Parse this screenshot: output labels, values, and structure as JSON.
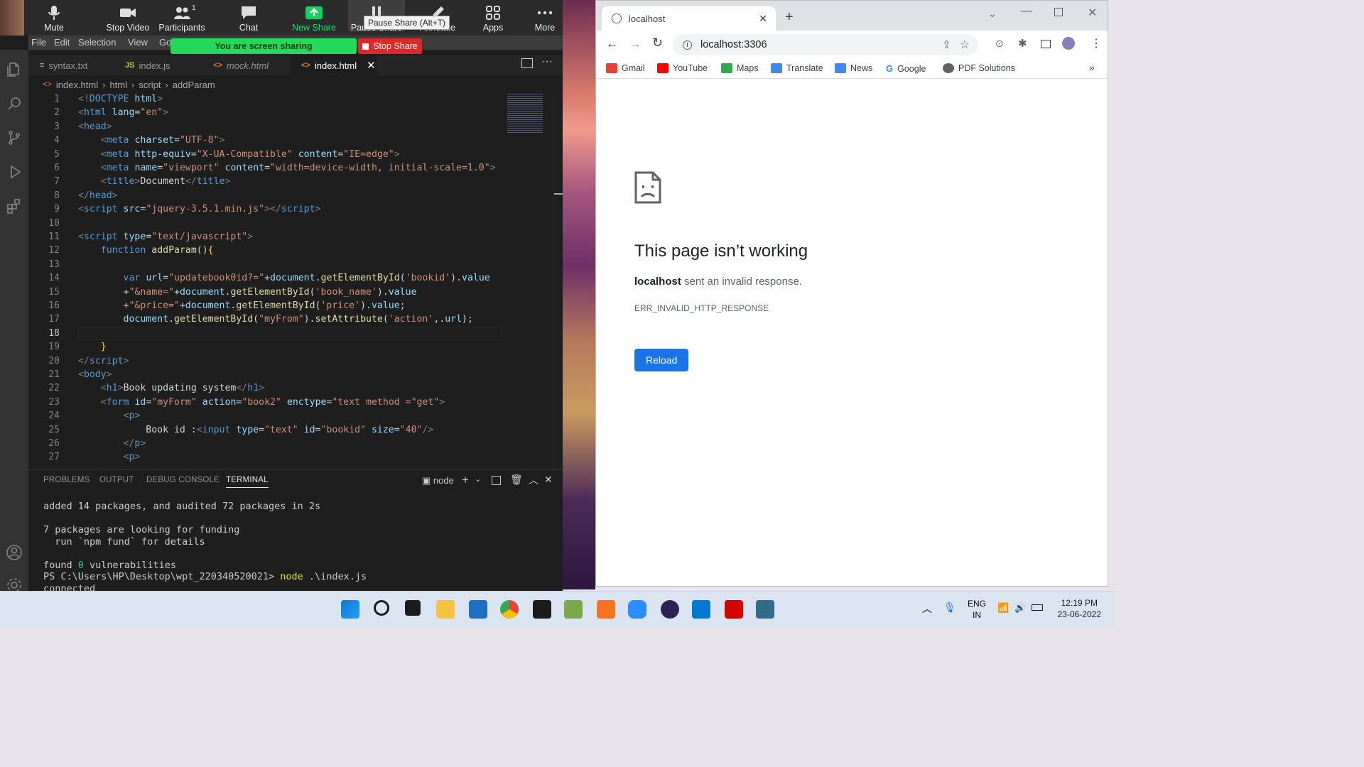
{
  "zoom": {
    "buttons": [
      {
        "label": "Mute"
      },
      {
        "label": "Stop Video"
      },
      {
        "label": "Participants",
        "count": "1"
      },
      {
        "label": "Chat"
      },
      {
        "label": "New Share"
      },
      {
        "label": "Pause Share"
      },
      {
        "label": "Annotate"
      },
      {
        "label": "Apps"
      },
      {
        "label": "More"
      }
    ],
    "tooltip": "Pause Share (Alt+T)",
    "sharing_text": "You are screen sharing",
    "stop_share": "Stop Share"
  },
  "vscode": {
    "menu": [
      "File",
      "Edit",
      "Selection",
      "View",
      "Go"
    ],
    "tabs": [
      {
        "icon": "≡",
        "label": "syntax.txt"
      },
      {
        "icon": "JS",
        "label": "index.js"
      },
      {
        "icon": "<>",
        "label": "mock.html"
      },
      {
        "icon": "<>",
        "label": "index.html"
      }
    ],
    "breadcrumb": [
      "index.html",
      "html",
      "script",
      "addParam"
    ],
    "line_numbers": [
      "1",
      "2",
      "3",
      "4",
      "5",
      "6",
      "7",
      "8",
      "9",
      "10",
      "11",
      "12",
      "13",
      "14",
      "15",
      "16",
      "17",
      "18",
      "19",
      "20",
      "21",
      "22",
      "23",
      "24",
      "25",
      "26",
      "27"
    ],
    "panel_tabs": [
      "PROBLEMS",
      "OUTPUT",
      "DEBUG CONSOLE",
      "TERMINAL"
    ],
    "terminal_name": "node",
    "terminal": {
      "l1": "added 14 packages, and audited 72 packages in 2s",
      "l2": "7 packages are looking for funding",
      "l3": "  run `npm fund` for details",
      "l4a": "found ",
      "l4b": "0",
      "l4c": " vulnerabilities",
      "l5a": "PS C:\\Users\\HP\\Desktop\\wpt_220340520021> ",
      "l5b": "node",
      "l5c": " .\\index.js",
      "l6": "connected"
    }
  },
  "chrome": {
    "tab_title": "localhost",
    "url": "localhost:3306",
    "bookmarks": [
      {
        "label": "Gmail",
        "color": "#ea4335"
      },
      {
        "label": "YouTube",
        "color": "#ff0000"
      },
      {
        "label": "Maps",
        "color": "#34a853"
      },
      {
        "label": "Translate",
        "color": "#4285f4"
      },
      {
        "label": "News",
        "color": "#4285f4"
      },
      {
        "label": "Google",
        "color": "#4285f4"
      },
      {
        "label": "PDF Solutions",
        "color": "#5f6368"
      }
    ],
    "error": {
      "title": "This page isn’t working",
      "host": "localhost",
      "desc": " sent an invalid response.",
      "code": "ERR_INVALID_HTTP_RESPONSE",
      "reload": "Reload"
    }
  },
  "taskbar": {
    "lang1": "ENG",
    "lang2": "IN",
    "time": "12:19 PM",
    "date": "23-06-2022"
  }
}
